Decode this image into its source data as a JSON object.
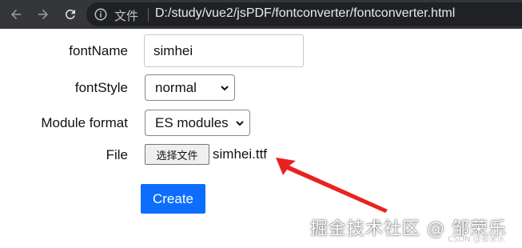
{
  "browser": {
    "scheme_label": "文件",
    "url": "D:/study/vue2/jsPDF/fontconverter/fontconverter.html",
    "icons": [
      "back-arrow-icon",
      "forward-arrow-icon",
      "reload-icon",
      "info-icon"
    ]
  },
  "form": {
    "font_name": {
      "label": "fontName",
      "value": "simhei"
    },
    "font_style": {
      "label": "fontStyle",
      "selected": "normal"
    },
    "module_format": {
      "label": "Module format",
      "selected": "ES modules"
    },
    "file": {
      "label": "File",
      "button_label": "选择文件",
      "file_name": "simhei.ttf"
    },
    "create_label": "Create"
  },
  "annotation": {
    "arrow_color": "#e8231f"
  },
  "watermark": {
    "text": "掘金技术社区 @ 邹荣乐",
    "small_text": "CSDN @邹荣乐"
  },
  "colors": {
    "toolbar_bg": "#35363a",
    "button_primary": "#0d6efd"
  }
}
